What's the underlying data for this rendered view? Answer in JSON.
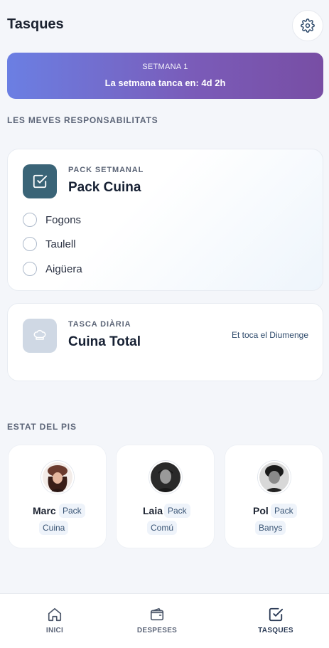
{
  "header": {
    "title": "Tasques",
    "settings_icon": "gear-icon"
  },
  "banner": {
    "week": "SETMANA 1",
    "closes": "La setmana tanca en: 4d 2h"
  },
  "sections": {
    "my_tasks": "LES MEVES RESPONSABILITATS",
    "flat_status": "ESTAT DEL PIS"
  },
  "pack": {
    "kicker": "PACK SETMANAL",
    "title": "Pack Cuina",
    "icon": "check-square-icon",
    "tasks": [
      {
        "label": "Fogons",
        "done": false
      },
      {
        "label": "Taulell",
        "done": false
      },
      {
        "label": "Aigüera",
        "done": false
      }
    ]
  },
  "daily": {
    "kicker": "TASCA DIÀRIA",
    "title": "Cuina Total",
    "icon": "chef-hat-icon",
    "note": "Et toca el Diumenge"
  },
  "members": [
    {
      "name": "Marc",
      "pack_line1": "Pack",
      "pack_line2": "Cuina"
    },
    {
      "name": "Laia",
      "pack_line1": "Pack",
      "pack_line2": "Comú"
    },
    {
      "name": "Pol",
      "pack_line1": "Pack",
      "pack_line2": "Banys"
    }
  ],
  "nav": {
    "items": [
      {
        "label": "INICI",
        "icon": "home-icon",
        "active": false
      },
      {
        "label": "DESPESES",
        "icon": "wallet-icon",
        "active": false
      },
      {
        "label": "TASQUES",
        "icon": "check-square-icon",
        "active": true
      }
    ]
  },
  "colors": {
    "accent": "#3a6477",
    "banner_start": "#6b7fe3",
    "banner_end": "#784ea4"
  }
}
